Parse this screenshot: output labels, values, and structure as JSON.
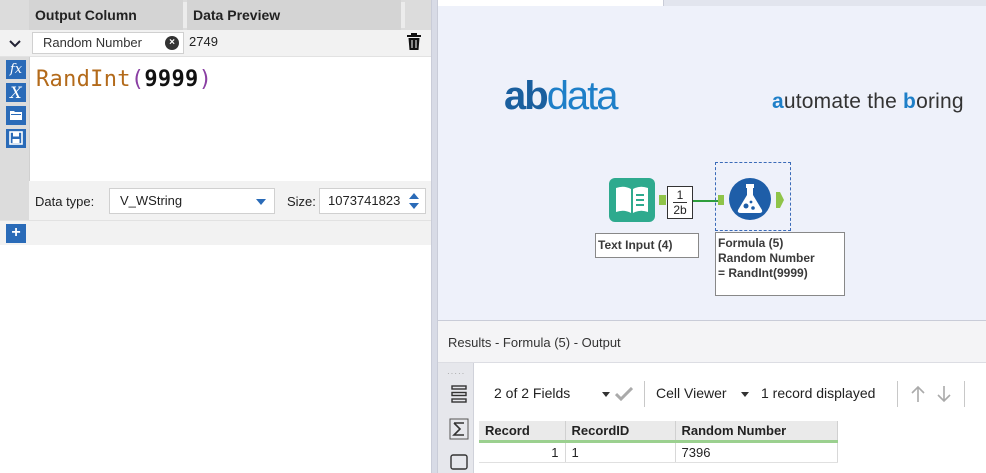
{
  "formula_grid": {
    "header_output_column": "Output Column",
    "header_data_preview": "Data Preview",
    "output_column_value": "Random Number",
    "data_preview_value": "2749",
    "expression_func": "RandInt",
    "expression_open": "(",
    "expression_arg": "9999",
    "expression_close": ")",
    "data_type_label": "Data type:",
    "data_type_value": "V_WString",
    "size_label": "Size:",
    "size_value": "1073741823",
    "side_buttons": [
      "fx",
      "X",
      "open",
      "save"
    ],
    "add_label": "+"
  },
  "canvas": {
    "logo_text_a": "ab",
    "logo_text_b": "data",
    "tagline_a": "a",
    "tagline_b": "utomate the ",
    "tagline_c": "b",
    "tagline_d": "oring",
    "connection_label_1": "1",
    "connection_label_2": "2b",
    "tool_text_input_label": "Text Input (4)",
    "tool_formula_label_1": "Formula (5)",
    "tool_formula_label_2": "Random Number",
    "tool_formula_label_3": "= RandInt(9999)"
  },
  "results": {
    "title": "Results - Formula (5) - Output",
    "fields_label": "2 of 2 Fields",
    "cell_viewer_label": "Cell Viewer",
    "records_label": "1 record displayed",
    "columns": [
      "Record",
      "RecordID",
      "Random Number"
    ],
    "rows": [
      [
        "1",
        "1",
        "7396"
      ]
    ]
  },
  "colors": {
    "accent": "#2a6bb8",
    "connector_green": "#8fc448",
    "connection_line": "#2e9e3c",
    "canvas_bg": "#eef1fa"
  },
  "icons": [
    "chevron-down-icon",
    "clear-icon",
    "trash-icon",
    "formula-fx-icon",
    "variable-icon",
    "open-folder-icon",
    "save-icon",
    "add-icon",
    "text-input-book-icon",
    "formula-flask-icon",
    "spinner-icon",
    "list-icon",
    "sigma-icon",
    "checkmark-icon",
    "arrow-up-icon",
    "arrow-down-icon"
  ]
}
